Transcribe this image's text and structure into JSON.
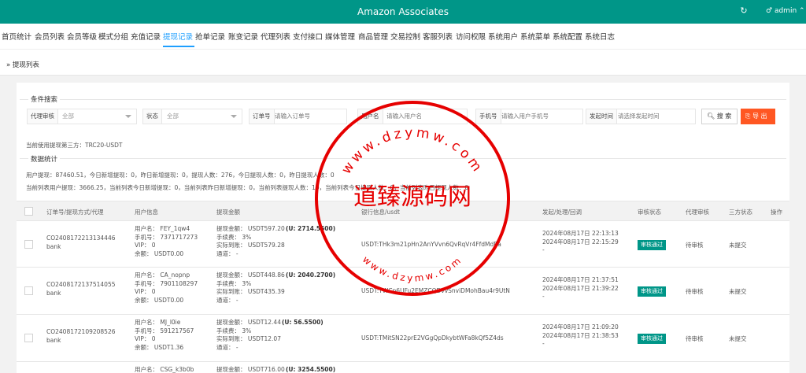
{
  "header": {
    "title": "Amazon Associates",
    "refresh_icon": "refresh-icon",
    "user": "admin",
    "user_icon": "user-icon"
  },
  "menu": [
    {
      "label": "首页统计"
    },
    {
      "label": "会员列表"
    },
    {
      "label": "会员等级"
    },
    {
      "label": "模式分组"
    },
    {
      "label": "充值记录"
    },
    {
      "label": "提现记录",
      "active": true
    },
    {
      "label": "抢单记录"
    },
    {
      "label": "账变记录"
    },
    {
      "label": "代理列表"
    },
    {
      "label": "支付接口"
    },
    {
      "label": "媒体管理"
    },
    {
      "label": "商品管理"
    },
    {
      "label": "交易控制"
    },
    {
      "label": "客服列表"
    },
    {
      "label": "访问权限"
    },
    {
      "label": "系统用户"
    },
    {
      "label": "系统菜单"
    },
    {
      "label": "系统配置"
    },
    {
      "label": "系统日志"
    }
  ],
  "breadcrumb": "» 提现列表",
  "search": {
    "title": "条件搜索",
    "fields": [
      {
        "label": "代理审核",
        "value": "全部",
        "type": "select"
      },
      {
        "label": "状态",
        "value": "全部",
        "type": "select"
      },
      {
        "label": "订单号",
        "placeholder": "请输入订单号",
        "type": "input"
      },
      {
        "label": "用户名",
        "placeholder": "请输入用户名",
        "type": "input"
      },
      {
        "label": "手机号",
        "placeholder": "请输入用户手机号",
        "type": "input"
      },
      {
        "label": "发起时间",
        "placeholder": "请选择发起时间",
        "type": "input"
      }
    ],
    "search_button": "搜 索",
    "export_button": "导 出"
  },
  "third_party": "当前使用提现第三方：TRC20-USDT",
  "stats": {
    "title": "数据统计",
    "line1": "用户提现：87460.51，今日新增提现：0，昨日新增提现：0，提现人数：276，今日提现人数：0，昨日提现人数：0",
    "line2": "当前列表用户提现：3666.25，当前列表今日新增提现：0，当前列表昨日新增提现：0，当前列表提现人数：10，当前列表今日提现人数：0，当前列表昨日提现人数：0"
  },
  "table": {
    "columns": [
      "订单号/提现方式/代理",
      "用户信息",
      "提现金额",
      "银行信息/usdt",
      "发起/处理/回调",
      "审核状态",
      "代理审核",
      "三方状态",
      "操作"
    ],
    "rows": [
      {
        "order": "CO2408172213134446",
        "method": "bank",
        "username": "用户名： FEY_1qw4",
        "phone": "手机号： 7371717273",
        "vip": "VIP： 0",
        "balance": "余额： USDT0.00",
        "amount": "提现金额： USDT597.20",
        "amount_u": "(U: 2714.5500)",
        "fee": "手续费： 3%",
        "received": "实际到账： USDT579.28",
        "channel": "通道： -",
        "bank": "USDT:THk3m21pHn2AnYVvn6QvRqVr4FfdMdRa",
        "time1": "2024年08月17日 22:13:13",
        "time2": "2024年08月17日 22:15:29",
        "time3": "-",
        "status": "审核通过",
        "agent": "待审核",
        "third": "未提交"
      },
      {
        "order": "CO2408172137514055",
        "method": "bank",
        "username": "用户名： CA_nopnp",
        "phone": "手机号： 7901108297",
        "vip": "VIP： 0",
        "balance": "余额： USDT0.00",
        "amount": "提现金额： USDT448.86",
        "amount_u": "(U: 2040.2700)",
        "fee": "手续费： 3%",
        "received": "实际到账： USDT435.39",
        "channel": "通道： -",
        "bank": "USDT:TWCp6UFu2EMZCQDvvSnviDMohBau4r9UtN",
        "time1": "2024年08月17日 21:37:51",
        "time2": "2024年08月17日 21:39:22",
        "time3": "-",
        "status": "审核通过",
        "agent": "待审核",
        "third": "未提交"
      },
      {
        "order": "CO2408172109208526",
        "method": "bank",
        "username": "用户名： MJ_l0ie",
        "phone": "手机号： 591217567",
        "vip": "VIP： 0",
        "balance": "余额： USDT1.36",
        "amount": "提现金额： USDT12.44",
        "amount_u": "(U: 56.5500)",
        "fee": "手续费： 3%",
        "received": "实际到账： USDT12.07",
        "channel": "通道： -",
        "bank": "USDT:TMitSN22prE2VGgQpDkybtWFa8kQf5Z4ds",
        "time1": "2024年08月17日 21:09:20",
        "time2": "2024年08月17日 21:38:53",
        "time3": "-",
        "status": "审核通过",
        "agent": "待审核",
        "third": "未提交"
      },
      {
        "username": "用户名： CSG_k3b0b",
        "amount": "提现金额： USDT716.00",
        "amount_u": "(U: 3254.5500)"
      }
    ]
  },
  "watermark": {
    "domain_top": "www.dzymw.com",
    "domain_bottom": "www.dzymw.com",
    "name": "道臻源码网",
    "color": "#e60000"
  }
}
